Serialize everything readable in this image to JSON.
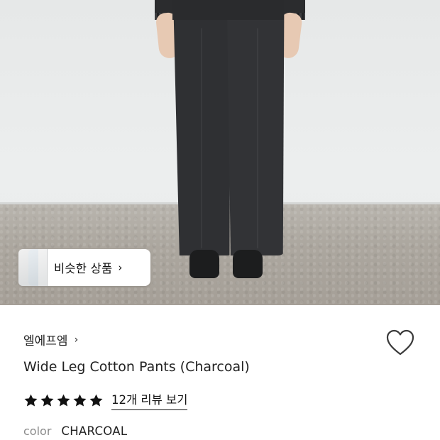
{
  "similar_products": {
    "label": "비슷한 상품",
    "chevron": "›"
  },
  "brand": {
    "name": "엘에프엠",
    "chevron": "›"
  },
  "product": {
    "title": "Wide Leg Cotton Pants (Charcoal)"
  },
  "rating": {
    "stars": 5,
    "reviews_label": "12개 리뷰 보기"
  },
  "color": {
    "label": "color",
    "value": "CHARCOAL"
  },
  "icons": {
    "wishlist": "heart-outline-icon",
    "star": "star-icon"
  },
  "colors": {
    "text": "#222222",
    "muted": "#8a8a8a",
    "star": "#111111"
  }
}
